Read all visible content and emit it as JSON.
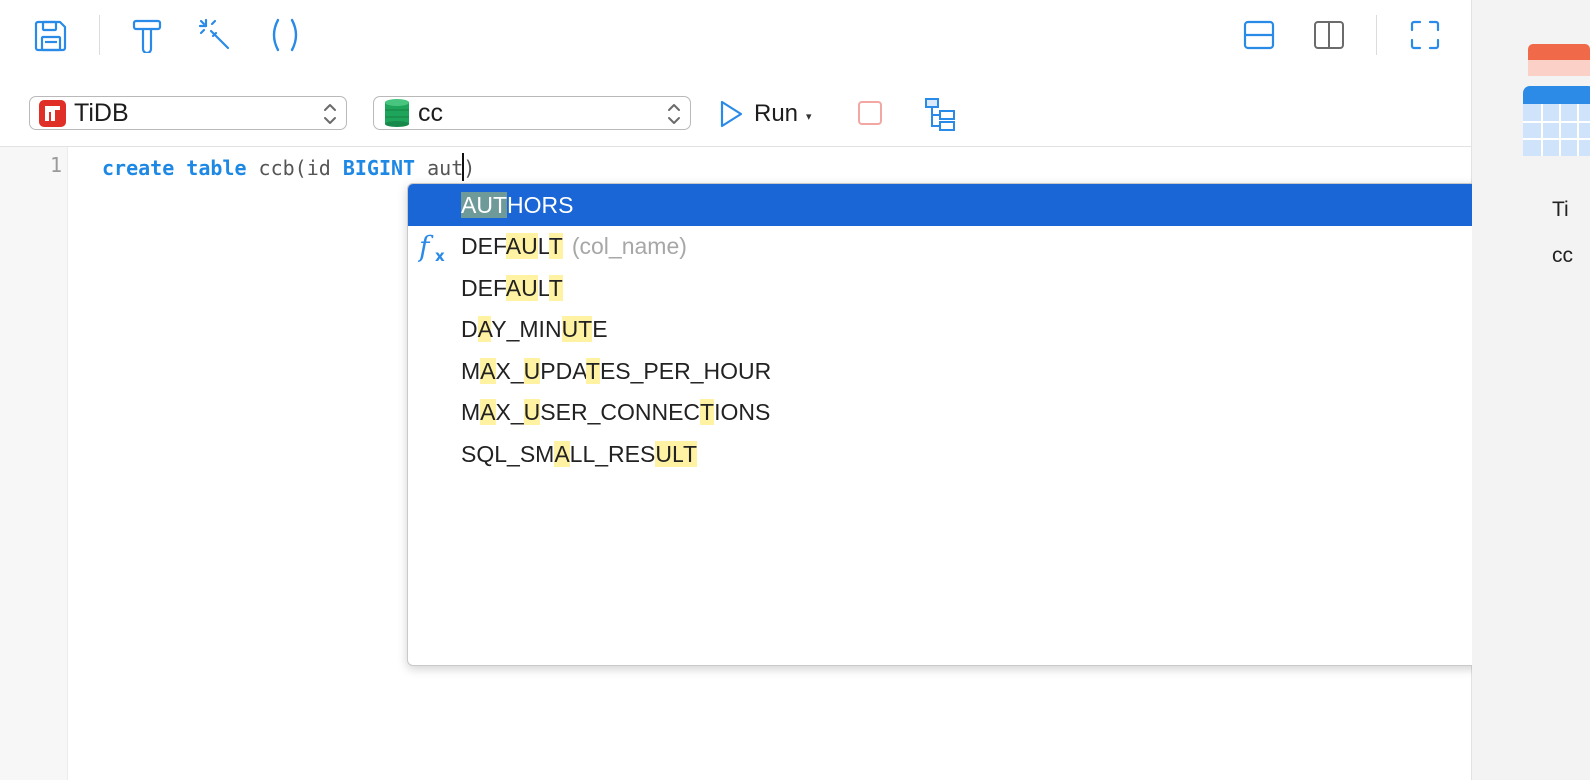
{
  "toolbar": {
    "icons": [
      "save-icon",
      "format-icon",
      "beautify-wand-icon",
      "parentheses-icon"
    ],
    "layout_icons": [
      "split-horizontal-icon",
      "split-vertical-icon",
      "fullscreen-icon"
    ]
  },
  "connection": {
    "name": "TiDB",
    "icon": "tidb-logo-icon",
    "accent": "#e02f27"
  },
  "database": {
    "name": "cc",
    "icon": "database-icon",
    "accent": "#1fa55b"
  },
  "run": {
    "label": "Run",
    "caret": "▾"
  },
  "editor": {
    "line_number": "1",
    "tokens": [
      {
        "text": "create",
        "kw": true
      },
      {
        "text": " ",
        "kw": false
      },
      {
        "text": "table",
        "kw": true
      },
      {
        "text": " ccb(id ",
        "kw": false
      },
      {
        "text": "BIGINT",
        "kw": true
      },
      {
        "text": " aut",
        "kw": false
      },
      {
        "text": "|cursor|",
        "kw": false
      },
      {
        "text": ")",
        "kw": false
      }
    ]
  },
  "autocomplete": {
    "selected_index": 0,
    "items": [
      {
        "parts": [
          {
            "t": "AUT",
            "h": true
          },
          {
            "t": "HORS",
            "h": false
          }
        ],
        "hint": "",
        "icon": ""
      },
      {
        "parts": [
          {
            "t": "DEF",
            "h": false
          },
          {
            "t": "AU",
            "h": true
          },
          {
            "t": "L",
            "h": false
          },
          {
            "t": "T",
            "h": true
          }
        ],
        "hint": "(col_name)",
        "icon": "function-fx-icon"
      },
      {
        "parts": [
          {
            "t": "DEF",
            "h": false
          },
          {
            "t": "AU",
            "h": true
          },
          {
            "t": "L",
            "h": false
          },
          {
            "t": "T",
            "h": true
          }
        ],
        "hint": "",
        "icon": ""
      },
      {
        "parts": [
          {
            "t": "D",
            "h": false
          },
          {
            "t": "A",
            "h": true
          },
          {
            "t": "Y_MIN",
            "h": false
          },
          {
            "t": "UT",
            "h": true
          },
          {
            "t": "E",
            "h": false
          }
        ],
        "hint": "",
        "icon": ""
      },
      {
        "parts": [
          {
            "t": "M",
            "h": false
          },
          {
            "t": "A",
            "h": true
          },
          {
            "t": "X_",
            "h": false
          },
          {
            "t": "U",
            "h": true
          },
          {
            "t": "PDA",
            "h": false
          },
          {
            "t": "T",
            "h": true
          },
          {
            "t": "ES_PER_HOUR",
            "h": false
          }
        ],
        "hint": "",
        "icon": ""
      },
      {
        "parts": [
          {
            "t": "M",
            "h": false
          },
          {
            "t": "A",
            "h": true
          },
          {
            "t": "X_",
            "h": false
          },
          {
            "t": "U",
            "h": true
          },
          {
            "t": "SER_CONNEC",
            "h": false
          },
          {
            "t": "T",
            "h": true
          },
          {
            "t": "IONS",
            "h": false
          }
        ],
        "hint": "",
        "icon": ""
      },
      {
        "parts": [
          {
            "t": "SQL_SM",
            "h": false
          },
          {
            "t": "A",
            "h": true
          },
          {
            "t": "LL_RES",
            "h": false
          },
          {
            "t": "UL",
            "h": true
          },
          {
            "t": "T",
            "h": true
          }
        ],
        "hint": "",
        "icon": ""
      }
    ]
  },
  "side_panel": {
    "icon": "table-grid-icon",
    "texts": [
      "Ti",
      "cc"
    ]
  },
  "colors": {
    "accent": "#1e88e5",
    "selection": "#1a66d6",
    "match_highlight": "#fff2a3"
  }
}
